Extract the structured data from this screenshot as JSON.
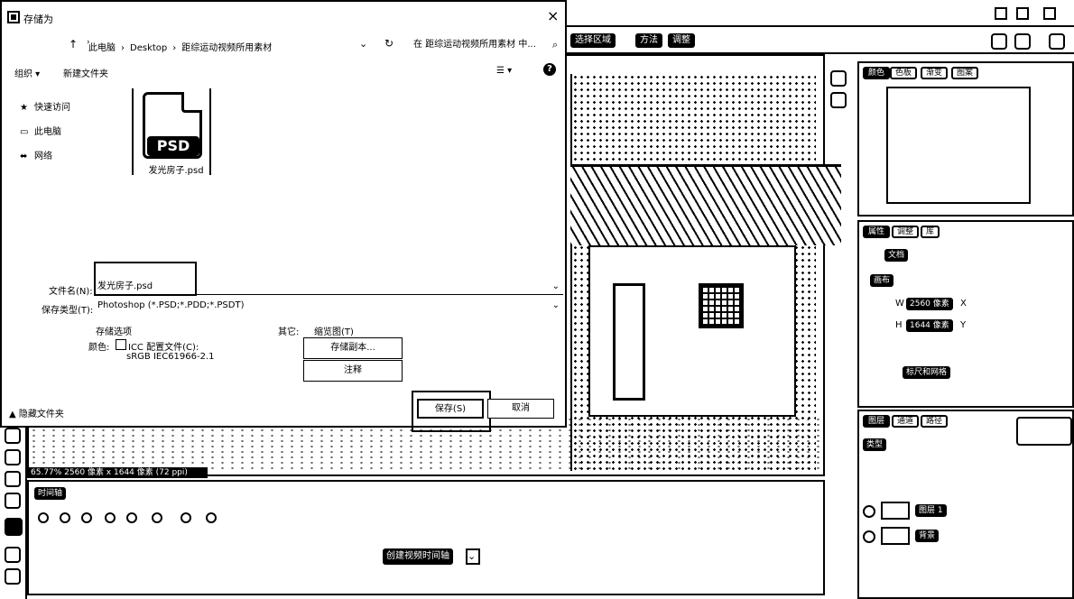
{
  "dialog": {
    "title": "存储为",
    "close_glyph": "×",
    "address": {
      "back_glyph": "↑",
      "forward_glyph": "›",
      "crumbs": [
        "此电脑",
        "Desktop",
        "距综运动视频所用素材"
      ],
      "sep_glyph": "›",
      "dd_glyph": "⌄",
      "refresh_glyph": "↻",
      "search_placeholder": "在 距综运动视频所用素材 中...",
      "search_glyph": "⌕"
    },
    "commands": {
      "organize": "组织 ▾",
      "new_folder": "新建文件夹",
      "view_glyph": "☰ ▾",
      "help_glyph": "?"
    },
    "nav": {
      "items": [
        {
          "icon": "★",
          "label": "快速访问"
        },
        {
          "icon": "▭",
          "label": "此电脑"
        },
        {
          "icon": "⬌",
          "label": "网络"
        }
      ]
    },
    "file": {
      "badge": "PSD",
      "name": "发光房子.psd"
    },
    "filename": {
      "label": "文件名(N):",
      "value": "发光房子.psd",
      "dd": "⌄"
    },
    "filetype": {
      "label": "保存类型(T):",
      "value": "Photoshop (*.PSD;*.PDD;*.PSDT)",
      "dd": "⌄"
    },
    "options": {
      "title": "存储选项",
      "color_label": "颜色:",
      "icc_label": "ICC 配置文件(C):",
      "icc_profile": "sRGB IEC61966-2.1",
      "other_label": "其它:",
      "thumbnail_label": "缩览图(T)",
      "save_copy": "存储副本...",
      "notes": "注释"
    },
    "hide_folders": "▲ 隐藏文件夹",
    "save_button": "保存(S)",
    "cancel_button": "取消"
  },
  "ps": {
    "window_controls": [
      "–",
      "□",
      "×"
    ],
    "options_bar": [
      "选择区域",
      "方法",
      "调整"
    ],
    "status": "65.77% 2560 像素 x 1644 像素 (72 ppi)",
    "timeline_tab": "时间轴",
    "create_timeline": "创建视频时间轴",
    "create_dd": "⌄",
    "top_panel_tabs": [
      "颜色",
      "色板",
      "渐变",
      "图案"
    ],
    "props_panel_tabs": [
      "属性",
      "调整",
      "库"
    ],
    "props": {
      "doc_label": "文档",
      "canvas_label": "画布",
      "width_label": "W",
      "width": "2560 像素",
      "height_label": "H",
      "height": "1644 像素",
      "ruler_label": "标尺和网格",
      "x_label": "X",
      "y_label": "Y"
    },
    "layers_panel_tabs": [
      "图层",
      "通道",
      "路径"
    ],
    "layers_kind": "类型",
    "layers": [
      "图层 1",
      "背景"
    ]
  }
}
